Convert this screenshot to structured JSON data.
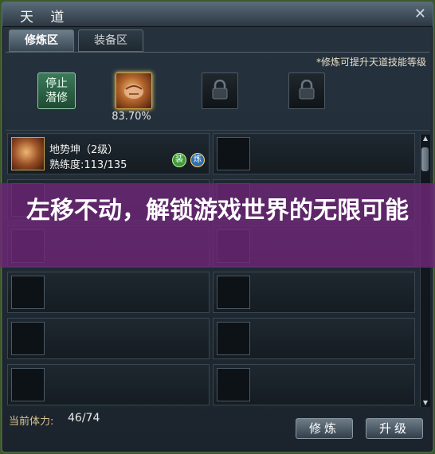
{
  "window": {
    "title": "天 道"
  },
  "tabs": [
    {
      "label": "修炼区"
    },
    {
      "label": "装备区"
    }
  ],
  "hint": "*修炼可提升天道技能等级",
  "stop_button": {
    "line1": "停止",
    "line2": "潜修"
  },
  "current_skill": {
    "progress_text": "83.70%"
  },
  "list": {
    "items": [
      {
        "name": "地势坤（2级）",
        "proficiency": "熟练度:113/135",
        "badge_equip": "装",
        "badge_train": "炼"
      }
    ]
  },
  "banner": {
    "text": "左移不动，解锁游戏世界的无限可能"
  },
  "footer": {
    "stamina_label": "当前体力:",
    "stamina_value": "46/74",
    "train_button": "修炼",
    "upgrade_button": "升级"
  },
  "icons": {
    "close": "close-icon",
    "lock": "lock-icon",
    "scroll_up": "scroll-up-icon",
    "scroll_down": "scroll-down-icon"
  },
  "colors": {
    "banner": "#6e2878",
    "frame": "#5f6d78",
    "skill_border": "#c9a44a"
  }
}
